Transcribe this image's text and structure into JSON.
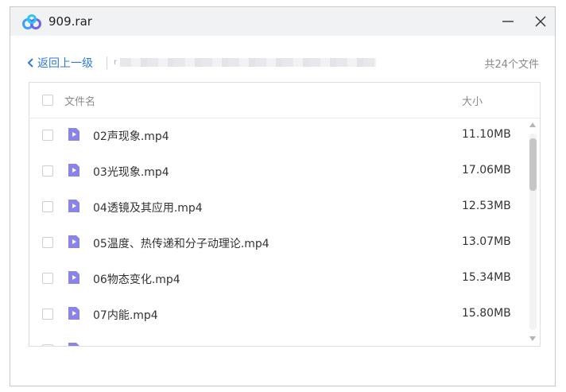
{
  "window": {
    "title": "909.rar"
  },
  "nav": {
    "back_label": "返回上一级",
    "path_prefix": "r",
    "count_label": "共24个文件"
  },
  "list": {
    "header": {
      "name_label": "文件名",
      "size_label": "大小"
    },
    "rows": [
      {
        "name": "02声现象.mp4",
        "size": "11.10MB",
        "icon": "video-file-icon"
      },
      {
        "name": "03光现象.mp4",
        "size": "17.06MB",
        "icon": "video-file-icon"
      },
      {
        "name": "04透镜及其应用.mp4",
        "size": "12.53MB",
        "icon": "video-file-icon"
      },
      {
        "name": "05温度、热传递和分子动理论.mp4",
        "size": "13.07MB",
        "icon": "video-file-icon"
      },
      {
        "name": "06物态变化.mp4",
        "size": "15.34MB",
        "icon": "video-file-icon"
      },
      {
        "name": "07内能.mp4",
        "size": "15.80MB",
        "icon": "video-file-icon"
      },
      {
        "name": "",
        "size": "",
        "icon": "video-file-icon"
      }
    ]
  },
  "colors": {
    "accent": "#2f7bd9",
    "file_icon": "#8b84e8"
  }
}
